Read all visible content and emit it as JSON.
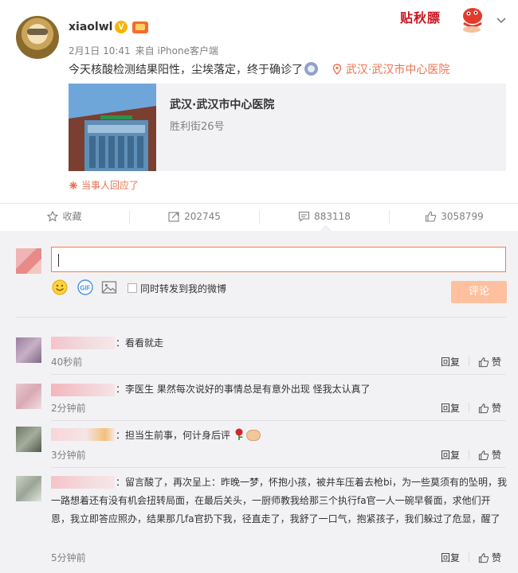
{
  "post": {
    "username": "xiaolwl",
    "verified_glyph": "V",
    "time": "2月1日 10:41",
    "source": "来自 iPhone客户端",
    "text": "今天核酸检测结果阳性，尘埃落定，终于确诊了",
    "location": "武汉·武汉市中心医院",
    "badge_text": "贴秋膘",
    "place_card": {
      "name": "武汉·武汉市中心医院",
      "address": "胜利街26号"
    },
    "replied": "当事人回应了"
  },
  "actions": {
    "favorite": "收藏",
    "repost": "202745",
    "comment": "883118",
    "like": "3058799"
  },
  "comment_box": {
    "forward_label": "同时转发到我的微博",
    "submit": "评论"
  },
  "comments": [
    {
      "text": "：看看就走",
      "time": "40秒前",
      "reply": "回复",
      "like": "赞"
    },
    {
      "text": "：李医生 果然每次说好的事情总是有意外出现 怪我太认真了",
      "time": "2分钟前",
      "reply": "回复",
      "like": "赞"
    },
    {
      "text": "：担当生前事，何计身后评",
      "time": "3分钟前",
      "reply": "回复",
      "like": "赞"
    },
    {
      "text": "：留言酸了，再次呈上：昨晚一梦，怀抱小孩，被井车压着去枪bi，为一些莫须有的坠明，我一路想着还有没有机会扭转局面，在最后关头，一厨师教我给那三个执行fa官一人一碗早餐面，求他们开恩，我立即答应照办，结果那几fa官扔下我，径直走了，我舒了一口气，抱紧孩子，我们躲过了危显，醒了",
      "time": "5分钟前",
      "reply": "回复",
      "like": "赞"
    }
  ],
  "colors": {
    "accent": "#eb7350",
    "input_border": "#fa7d3c",
    "submit_bg": "#ffc09f",
    "panel_bg": "#f2f2f5"
  },
  "icons": [
    "chevron-down-icon",
    "location-pin-icon",
    "star-icon",
    "repost-icon",
    "comment-icon",
    "like-icon",
    "smiley-icon",
    "gif-icon",
    "image-icon"
  ]
}
